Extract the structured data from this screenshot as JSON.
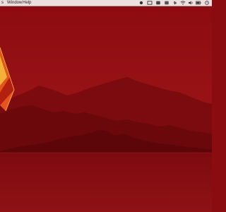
{
  "menubar": {
    "items": [
      {
        "label": "s"
      },
      {
        "label": "Window"
      },
      {
        "label": "Help"
      }
    ],
    "status_icons": [
      "status-dot-icon",
      "status-box-icon",
      "status-app-icon",
      "status-app-icon",
      "bluetooth-icon",
      "wifi-icon",
      "volume-icon",
      "battery-icon",
      "clock-icon"
    ]
  },
  "wallpaper": {
    "colors": {
      "sky_top": "#8d0c10",
      "sky_bottom": "#a31a1c",
      "mountain_far": "#7c0b0f",
      "mountain_mid": "#6b080c",
      "mountain_near": "#5c060a",
      "water": "#8b0f12",
      "crystal_orange": "#e7531d",
      "crystal_yellow": "#f4b03a",
      "crystal_dark": "#b3200f"
    }
  }
}
